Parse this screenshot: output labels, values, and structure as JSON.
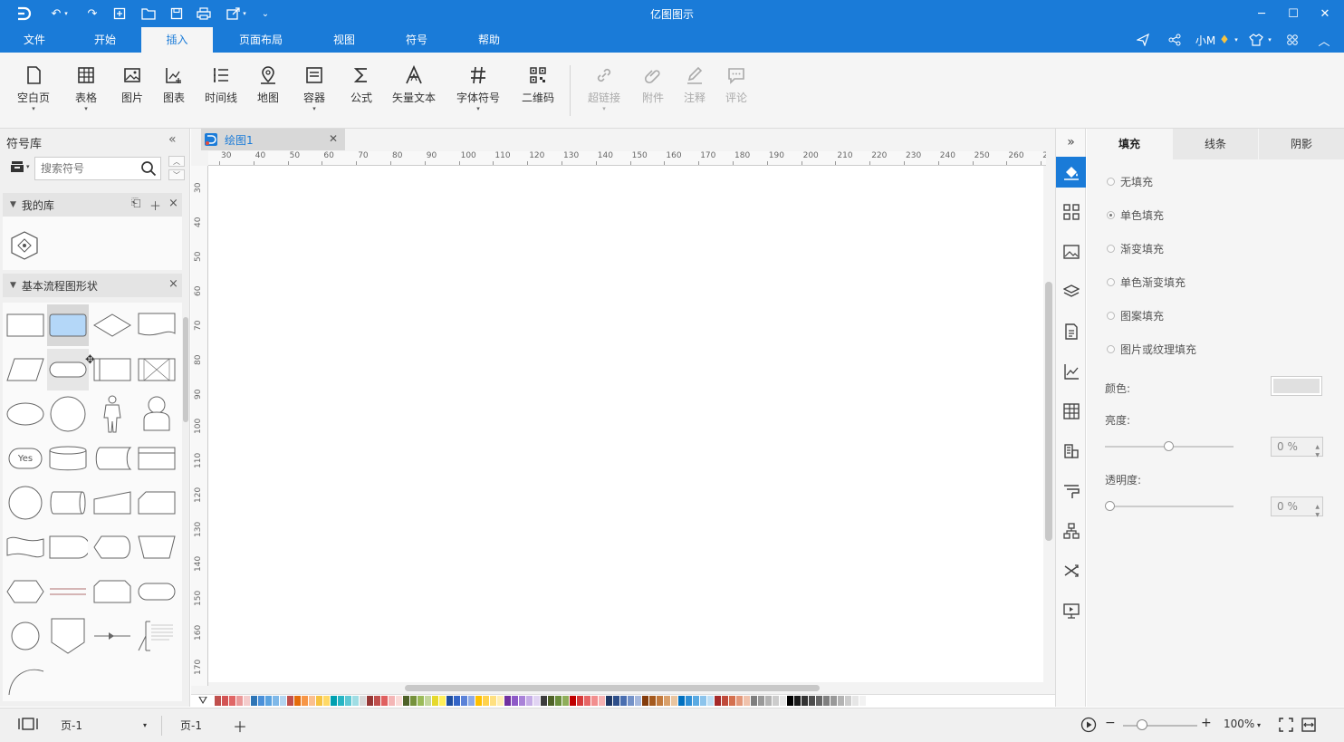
{
  "app": {
    "title": "亿图图示"
  },
  "menu": {
    "items": [
      "文件",
      "开始",
      "插入",
      "页面布局",
      "视图",
      "符号",
      "帮助"
    ],
    "active_index": 2,
    "user": "小M"
  },
  "ribbon": {
    "buttons": [
      {
        "label": "空白页",
        "icon": "blank-page-icon",
        "dropdown": true
      },
      {
        "label": "表格",
        "icon": "table-icon",
        "dropdown": true
      },
      {
        "label": "图片",
        "icon": "image-icon",
        "dropdown": false
      },
      {
        "label": "图表",
        "icon": "chart-icon",
        "dropdown": false
      },
      {
        "label": "时间线",
        "icon": "timeline-icon",
        "dropdown": false
      },
      {
        "label": "地图",
        "icon": "map-icon",
        "dropdown": false
      },
      {
        "label": "容器",
        "icon": "container-icon",
        "dropdown": true
      },
      {
        "label": "公式",
        "icon": "formula-icon",
        "dropdown": false
      },
      {
        "label": "矢量文本",
        "icon": "vector-text-icon",
        "dropdown": false
      },
      {
        "label": "字体符号",
        "icon": "font-symbol-icon",
        "dropdown": true
      },
      {
        "label": "二维码",
        "icon": "qrcode-icon",
        "dropdown": false
      },
      {
        "label": "超链接",
        "icon": "hyperlink-icon",
        "dropdown": true,
        "disabled": true
      },
      {
        "label": "附件",
        "icon": "attachment-icon",
        "dropdown": false,
        "disabled": true
      },
      {
        "label": "注释",
        "icon": "annotation-icon",
        "dropdown": false,
        "disabled": true
      },
      {
        "label": "评论",
        "icon": "comment-icon",
        "dropdown": false,
        "disabled": true
      }
    ]
  },
  "library": {
    "title": "符号库",
    "search_placeholder": "搜索符号",
    "my_library": "我的库",
    "basic_flowchart": "基本流程图形状",
    "yes_label": "Yes"
  },
  "document": {
    "tab_name": "绘图1"
  },
  "ruler": {
    "h_ticks": [
      "30",
      "40",
      "50",
      "60",
      "70",
      "80",
      "90",
      "100",
      "110",
      "120",
      "130",
      "140",
      "150",
      "160",
      "170",
      "180",
      "190",
      "200",
      "210",
      "220",
      "230",
      "240",
      "250",
      "260",
      "2"
    ],
    "v_ticks": [
      "30",
      "40",
      "50",
      "60",
      "70",
      "80",
      "90",
      "100",
      "110",
      "120",
      "130",
      "140",
      "150",
      "160",
      "170"
    ]
  },
  "palette": [
    "#c0504d",
    "#d35454",
    "#e06666",
    "#ea9999",
    "#f4cccc",
    "#2e75b6",
    "#4a90d9",
    "#5ba3e0",
    "#7fb8e8",
    "#b4d5f0",
    "#c0504d",
    "#e46c0a",
    "#f79646",
    "#fabf8f",
    "#f6c342",
    "#ffd966",
    "#00a0b0",
    "#26b5c4",
    "#5ec8d4",
    "#9fdde4",
    "#d8d8d8",
    "#953735",
    "#c0504d",
    "#e06060",
    "#f4b6b6",
    "#fadbd8",
    "#4f6228",
    "#76923c",
    "#9bbb59",
    "#c3d69b",
    "#e6d92c",
    "#ffef5a",
    "#1f4e9f",
    "#3465c7",
    "#5b82d8",
    "#8eaae6",
    "#ffc000",
    "#ffd24d",
    "#ffe080",
    "#ffeeb3",
    "#7030a0",
    "#8e5ac7",
    "#a982d8",
    "#c5ace6",
    "#e1d4f3",
    "#3c3c3c",
    "#4f6228",
    "#6b8e3c",
    "#8fae5a",
    "#c00000",
    "#d63a3a",
    "#e66666",
    "#f28e8e",
    "#f6b2b2",
    "#1f3864",
    "#2e4f8a",
    "#4a6fb0",
    "#7492c8",
    "#a5b8dd",
    "#843c0c",
    "#a55a1e",
    "#c27a3d",
    "#d9a06b",
    "#e9c5a0",
    "#0070c0",
    "#2f8fd6",
    "#5aaae2",
    "#8cc4ec",
    "#bfdff5",
    "#a52a2a",
    "#c04a3a",
    "#d4704f",
    "#e3987a",
    "#f0c2ac",
    "#7f7f7f",
    "#999999",
    "#b3b3b3",
    "#cccccc",
    "#e6e6e6",
    "#000000",
    "#1a1a1a",
    "#333333",
    "#4d4d4d",
    "#666666",
    "#808080",
    "#999999",
    "#b3b3b3",
    "#cccccc",
    "#e6e6e6",
    "#f2f2f2"
  ],
  "properties": {
    "tabs": [
      "填充",
      "线条",
      "阴影"
    ],
    "fill_options": [
      "无填充",
      "单色填充",
      "渐变填充",
      "单色渐变填充",
      "图案填充",
      "图片或纹理填充"
    ],
    "selected_fill": 1,
    "color_label": "颜色:",
    "color_value": "#e0e0e0",
    "brightness_label": "亮度:",
    "brightness_value": "0 %",
    "brightness_level": 0.5,
    "opacity_label": "透明度:",
    "opacity_value": "0 %",
    "opacity_level": 0
  },
  "status": {
    "page_selector": "页-1",
    "page_tab": "页-1",
    "zoom": "100%"
  }
}
